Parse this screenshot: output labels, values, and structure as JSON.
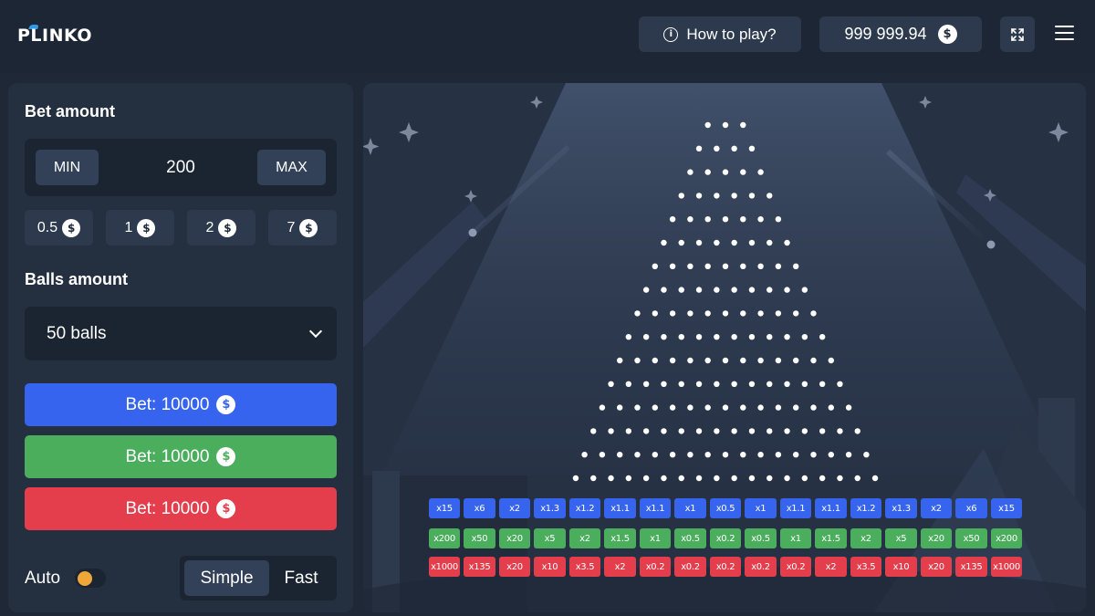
{
  "header": {
    "logo": "PLINKO",
    "how_to_play": "How to play?",
    "balance": "999 999.94",
    "coin_symbol": "$"
  },
  "bet_panel": {
    "bet_amount_label": "Bet amount",
    "min_label": "MIN",
    "max_label": "MAX",
    "bet_value": "200",
    "quick_chips": [
      "0.5",
      "1",
      "2",
      "7"
    ],
    "balls_amount_label": "Balls amount",
    "balls_selected": "50 balls",
    "bet_buttons": [
      {
        "label": "Bet: 10000",
        "color": "#3764ef"
      },
      {
        "label": "Bet: 10000",
        "color": "#4aae5c"
      },
      {
        "label": "Bet: 10000",
        "color": "#e43d4b"
      }
    ],
    "auto_label": "Auto",
    "auto_enabled": false,
    "modes": [
      "Simple",
      "Fast"
    ],
    "mode_selected": "Simple"
  },
  "board": {
    "peg_rows": 16,
    "colors": {
      "blue": "#3764ef",
      "green": "#4aae5c",
      "red": "#e43d4b"
    },
    "multipliers": {
      "blue": [
        "x15",
        "x6",
        "x2",
        "x1.3",
        "x1.2",
        "x1.1",
        "x1.1",
        "x1",
        "x0.5",
        "x1",
        "x1.1",
        "x1.1",
        "x1.2",
        "x1.3",
        "x2",
        "x6",
        "x15"
      ],
      "green": [
        "x200",
        "x50",
        "x20",
        "x5",
        "x2",
        "x1.5",
        "x1",
        "x0.5",
        "x0.2",
        "x0.5",
        "x1",
        "x1.5",
        "x2",
        "x5",
        "x20",
        "x50",
        "x200"
      ],
      "red": [
        "x1000",
        "x135",
        "x20",
        "x10",
        "x3.5",
        "x2",
        "x0.2",
        "x0.2",
        "x0.2",
        "x0.2",
        "x0.2",
        "x2",
        "x3.5",
        "x10",
        "x20",
        "x135",
        "x1000"
      ]
    }
  }
}
